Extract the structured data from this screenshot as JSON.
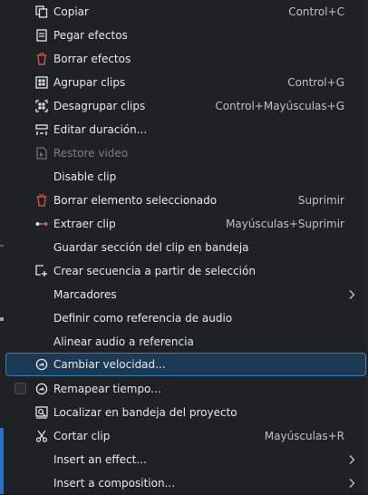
{
  "colors": {
    "menu_bg": "#1f2225",
    "accent": "#3d7bb0",
    "danger": "#d94a4a"
  },
  "menu": {
    "items": [
      {
        "icon": "copy-icon",
        "label": "Copiar",
        "shortcut": "Control+C"
      },
      {
        "icon": "paste-effects-icon",
        "label": "Pegar efectos",
        "shortcut": ""
      },
      {
        "icon": "trash-icon",
        "label": "Borrar efectos",
        "shortcut": ""
      },
      {
        "icon": "group-icon",
        "label": "Agrupar clips",
        "shortcut": "Control+G"
      },
      {
        "icon": "ungroup-icon",
        "label": "Desagrupar clips",
        "shortcut": "Control+Mayúsculas+G"
      },
      {
        "icon": "duration-icon",
        "label": "Editar duración...",
        "shortcut": ""
      },
      {
        "icon": "restore-video-icon",
        "label": "Restore video",
        "shortcut": "",
        "disabled": true
      },
      {
        "icon": "",
        "label": "Disable clip",
        "shortcut": ""
      },
      {
        "icon": "trash-icon",
        "label": "Borrar elemento seleccionado",
        "shortcut": "Suprimir"
      },
      {
        "icon": "extract-icon",
        "label": "Extraer clip",
        "shortcut": "Mayúsculas+Suprimir"
      },
      {
        "icon": "",
        "label": "Guardar sección del clip en bandeja",
        "shortcut": ""
      },
      {
        "icon": "create-sequence-icon",
        "label": "Crear secuencia a partir de selección",
        "shortcut": ""
      },
      {
        "icon": "",
        "label": "Marcadores",
        "shortcut": "",
        "submenu": true
      },
      {
        "icon": "",
        "label": "Definir como referencia de audio",
        "shortcut": ""
      },
      {
        "icon": "",
        "label": "Alinear audio a referencia",
        "shortcut": ""
      },
      {
        "icon": "speed-icon",
        "label": "Cambiar velocidad...",
        "shortcut": "",
        "selected": true
      },
      {
        "icon": "speed-icon",
        "label": "Remapear tiempo...",
        "shortcut": "",
        "checkbox": true
      },
      {
        "icon": "locate-icon",
        "label": "Localizar en bandeja del proyecto",
        "shortcut": ""
      },
      {
        "icon": "scissors-icon",
        "label": "Cortar clip",
        "shortcut": "Mayúsculas+R"
      },
      {
        "icon": "",
        "label": "Insert an effect...",
        "shortcut": "",
        "submenu": true
      },
      {
        "icon": "",
        "label": "Insert a composition...",
        "shortcut": "",
        "submenu": true
      }
    ]
  }
}
